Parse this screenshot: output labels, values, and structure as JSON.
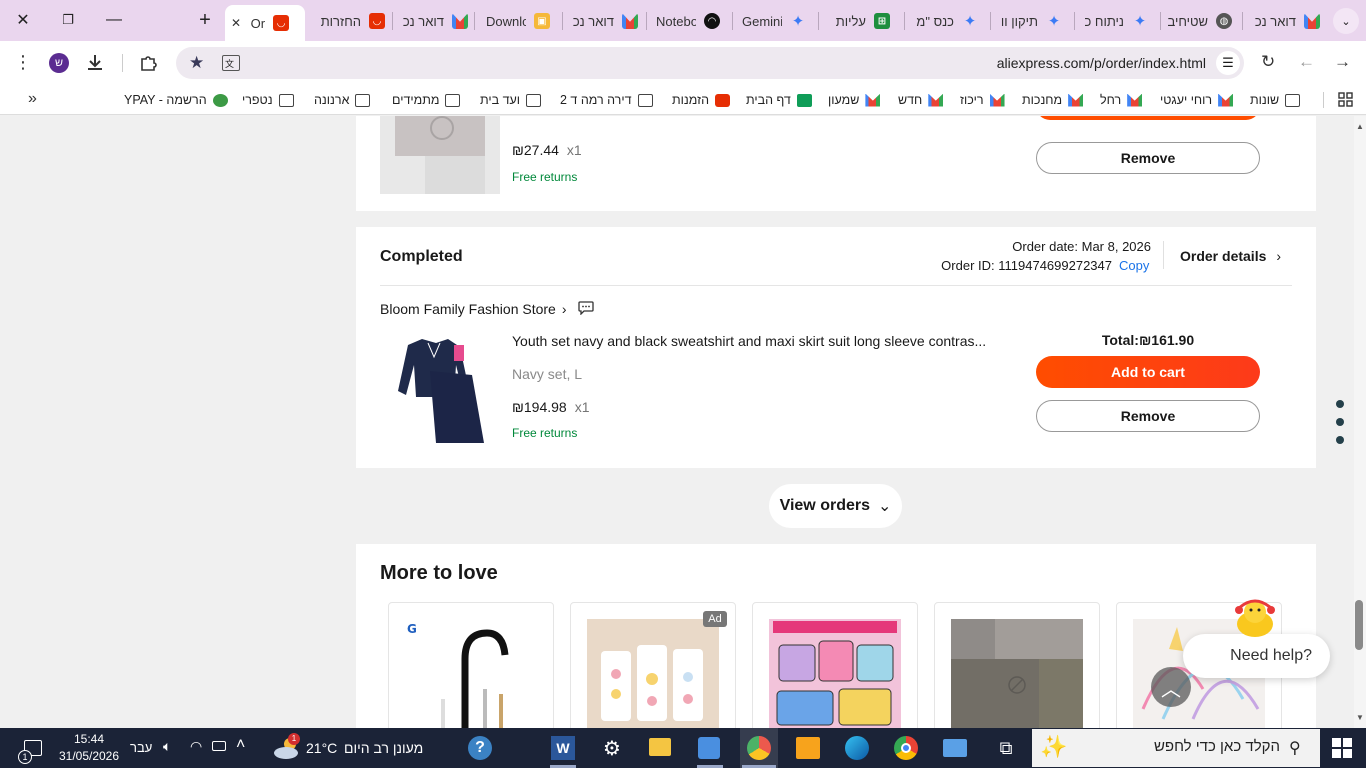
{
  "browser": {
    "tabs": [
      {
        "title": "דואר נכ",
        "favicon": "gmail-icon"
      },
      {
        "title": "שטיחיב",
        "favicon": "globe-icon"
      },
      {
        "title": "ניתוח כ",
        "favicon": "gemini-icon"
      },
      {
        "title": "תיקון וו",
        "favicon": "gemini-icon"
      },
      {
        "title": "כנס \"מ",
        "favicon": "gemini-icon"
      },
      {
        "title": "עליות",
        "favicon": "sheets-icon"
      },
      {
        "title": "Gemini",
        "favicon": "gemini-icon"
      },
      {
        "title": "Notebo",
        "favicon": "notebooklm-icon"
      },
      {
        "title": "דואר נכ",
        "favicon": "gmail-icon"
      },
      {
        "title": "Downlc",
        "favicon": "download-icon"
      },
      {
        "title": "דואר נכ",
        "favicon": "gmail-icon"
      },
      {
        "title": "החזרות",
        "favicon": "aliexpress-icon"
      },
      {
        "title": "Or",
        "favicon": "aliexpress-icon",
        "active": true
      }
    ],
    "url": "aliexpress.com/p/order/index.html",
    "profile_initial": "ש",
    "bookmarks": [
      {
        "label": "שונות",
        "icon": "folder-icon"
      },
      {
        "label": "רוחי יעגטי",
        "icon": "gmail-icon"
      },
      {
        "label": "רחל",
        "icon": "gmail-icon"
      },
      {
        "label": "מחנכות",
        "icon": "gmail-icon"
      },
      {
        "label": "ריכוז",
        "icon": "gmail-icon"
      },
      {
        "label": "חדש",
        "icon": "gmail-icon"
      },
      {
        "label": "שמעון",
        "icon": "gmail-icon"
      },
      {
        "label": "דף הבית",
        "icon": "classroom-icon"
      },
      {
        "label": "הזמנות",
        "icon": "aliexpress-icon"
      },
      {
        "label": "דירה רמה ד 2",
        "icon": "folder-icon"
      },
      {
        "label": "ועד בית",
        "icon": "folder-icon"
      },
      {
        "label": "מתמידים",
        "icon": "folder-icon"
      },
      {
        "label": "ארנונה",
        "icon": "folder-icon"
      },
      {
        "label": "נטפרי",
        "icon": "folder-icon"
      },
      {
        "label": "YPAY - הרשמה",
        "icon": "ypay-icon"
      }
    ],
    "bookmarks_overflow": "»"
  },
  "prev_order": {
    "price": "₪27.44",
    "qty": "x1",
    "free_returns": "Free returns",
    "remove_label": "Remove"
  },
  "order": {
    "status": "Completed",
    "order_date": "Order date: Mar 8, 2026",
    "order_id_label": "Order ID: 1119474699272347",
    "copy_label": "Copy",
    "details_label": "Order details",
    "store": "Bloom Family Fashion Store",
    "product_title": "Youth set navy and black sweatshirt and maxi skirt suit long sleeve contras...",
    "variant": "Navy set, L",
    "price": "₪194.98",
    "qty": "x1",
    "free_returns": "Free returns",
    "total_label": "Total:",
    "total_value": "₪161.90",
    "add_to_cart_label": "Add to cart",
    "remove_label": "Remove"
  },
  "view_orders_label": "View orders",
  "more_to_love": {
    "title": "More to love",
    "ad_badge": "Ad",
    "products": [
      "faucet-image",
      "hair-clips-image",
      "doodle-bags-image",
      "placeholder-image",
      "unicorn-headband-image"
    ]
  },
  "help": {
    "label": "Need help?"
  },
  "taskbar": {
    "search_placeholder": "הקלד כאן כדי לחפש",
    "weather_text": "מעונן רב היום",
    "temperature": "21°C",
    "language": "עבר",
    "time": "15:44",
    "date": "31/05/2026",
    "notification_count": "1",
    "weather_badge": "1"
  },
  "colors": {
    "accent": "#ff4d00",
    "link": "#1a73e8",
    "green": "#00883a",
    "tabbar": "#ead6ee",
    "taskbar": "#1b2337"
  }
}
